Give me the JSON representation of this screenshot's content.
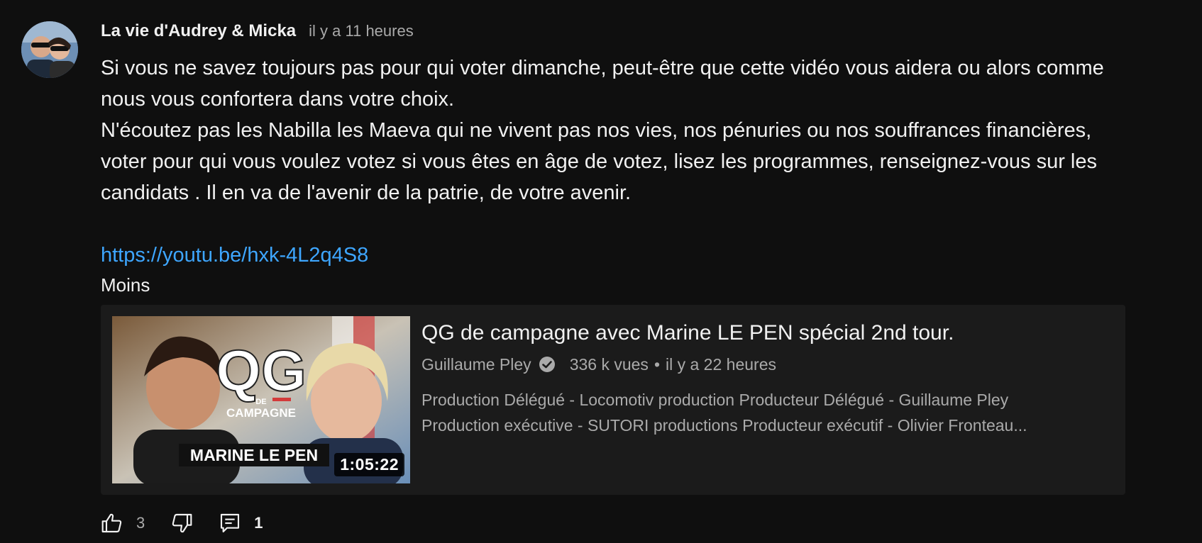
{
  "post": {
    "author": "La vie d'Audrey & Micka",
    "time_ago": "il y a 11 heures",
    "avatar_icon": "channel-avatar",
    "body_lines": [
      "Si vous ne savez toujours pas pour qui voter dimanche, peut-être que cette vidéo vous aidera ou alors comme nous vous confortera dans votre choix.",
      "N'écoutez pas les Nabilla les Maeva qui ne vivent pas nos vies, nos pénuries ou nos souffrances financières, voter pour qui vous voulez votez si vous êtes en âge de votez, lisez les programmes, renseignez-vous sur les candidats . Il en va de l'avenir de la patrie, de votre avenir."
    ],
    "link": "https://youtu.be/hxk-4L2q4S8",
    "less_label": "Moins"
  },
  "video": {
    "title": "QG de campagne avec Marine LE PEN spécial 2nd tour.",
    "channel": "Guillaume Pley",
    "verified_icon": "verified-check-icon",
    "views": "336 k vues",
    "separator": "•",
    "published": "il y a 22 heures",
    "description_lines": [
      "Production Délégué - Locomotiv production Producteur Délégué - Guillaume Pley",
      "Production exécutive - SUTORI productions Producteur exécutif - Olivier Fronteau..."
    ],
    "duration": "1:05:22",
    "thumbnail": {
      "big_text": "QG",
      "small_text": "DE",
      "campaign_text": "CAMPAGNE",
      "banner_text": "MARINE LE PEN"
    }
  },
  "actions": {
    "like_icon": "thumbs-up-icon",
    "like_count": "3",
    "dislike_icon": "thumbs-down-icon",
    "reply_icon": "comment-icon",
    "reply_count": "1"
  },
  "colors": {
    "background": "#0f0f0f",
    "card": "#1b1b1b",
    "link": "#3ea6ff",
    "secondary_text": "#aaaaaa"
  }
}
